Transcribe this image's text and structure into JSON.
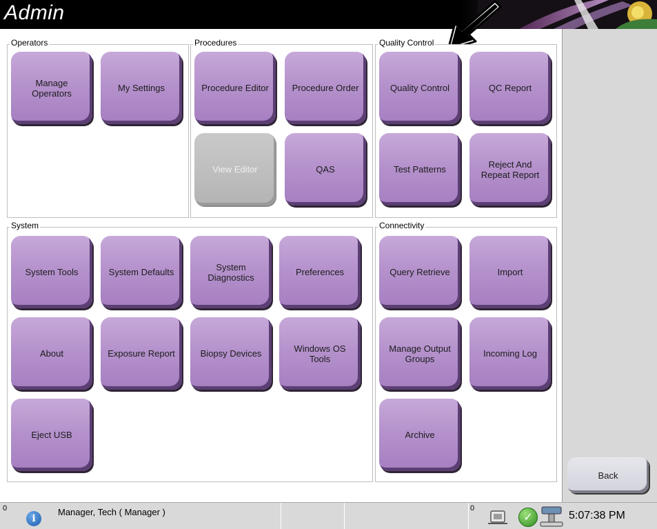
{
  "app": {
    "title": "Admin"
  },
  "colors": {
    "tile": "#b592cc",
    "tile_disabled": "#bdbdbd",
    "titlebar": "#000000",
    "status_bar": "#d9d9d9"
  },
  "sections": {
    "operators": {
      "label": "Operators",
      "buttons": [
        "Manage Operators",
        "My Settings"
      ]
    },
    "procedures": {
      "label": "Procedures",
      "buttons": [
        "Procedure Editor",
        "Procedure Order",
        "View Editor",
        "QAS"
      ]
    },
    "quality_control": {
      "label": "Quality Control",
      "buttons": [
        "Quality Control",
        "QC Report",
        "Test Patterns",
        "Reject And Repeat Report"
      ]
    },
    "system": {
      "label": "System",
      "buttons": [
        "System Tools",
        "System Defaults",
        "System Diagnostics",
        "Preferences",
        "About",
        "Exposure Report",
        "Biopsy Devices",
        "Windows OS Tools",
        "Eject USB"
      ]
    },
    "connectivity": {
      "label": "Connectivity",
      "buttons": [
        "Query Retrieve",
        "Import",
        "Manage Output Groups",
        "Incoming Log",
        "Archive"
      ]
    }
  },
  "back_label": "Back",
  "status": {
    "alerts_count": "0",
    "user": "Manager, Tech ( Manager )",
    "tray_count": "0",
    "time": "5:07:38 PM",
    "icons": [
      "info-icon",
      "media-icon",
      "connected-check-icon",
      "device-icon"
    ]
  }
}
